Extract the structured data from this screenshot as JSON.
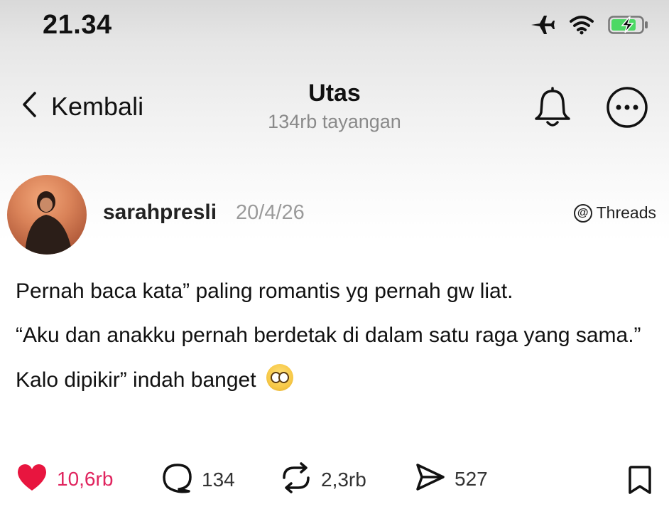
{
  "status_bar": {
    "time": "21.34",
    "icons": [
      "airplane-icon",
      "wifi-icon",
      "battery-charging-icon"
    ],
    "battery_color": "#4cd964"
  },
  "nav": {
    "back_label": "Kembali",
    "title": "Utas",
    "subtitle": "134rb tayangan",
    "icons": [
      "bell-icon",
      "more-icon"
    ]
  },
  "post": {
    "username": "sarahpresli",
    "date": "20/4/26",
    "source": "Threads",
    "paragraphs": [
      "Pernah baca kata” paling romantis yg pernah gw liat.",
      "“Aku dan anakku pernah berdetak di dalam satu raga yang sama.”",
      "Kalo dipikir” indah banget"
    ],
    "emoji": "pleading-face-emoji"
  },
  "actions": {
    "likes": "10,6rb",
    "comments": "134",
    "reposts": "2,3rb",
    "shares": "527",
    "like_color": "#e0245e"
  }
}
